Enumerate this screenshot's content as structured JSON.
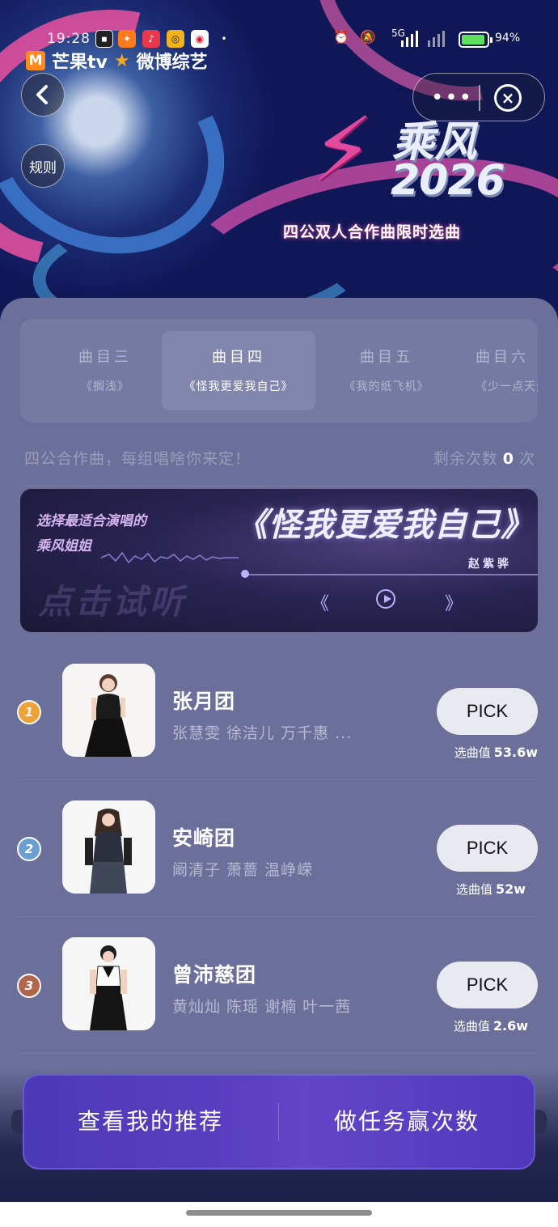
{
  "status_bar": {
    "time": "19:28",
    "network": "5G",
    "battery_level": 94,
    "battery_text": "94%",
    "app_icons": [
      "icon-a",
      "icon-b",
      "icon-c",
      "icon-d",
      "weibo-icon"
    ]
  },
  "header": {
    "brand_mango": "芒果tv",
    "brand_weibo": "微博综艺",
    "rules_label": "规则",
    "show_name": "乘风",
    "show_year": "2026",
    "subtitle": "四公双人合作曲限时选曲"
  },
  "tabs": [
    {
      "title": "曲目三",
      "song": "《搁浅》",
      "active": false
    },
    {
      "title": "曲目四",
      "song": "《怪我更爱我自己》",
      "active": true
    },
    {
      "title": "曲目五",
      "song": "《我的纸飞机》",
      "active": false
    },
    {
      "title": "曲目六",
      "song": "《少一点天分》",
      "active": false
    }
  ],
  "info": {
    "tagline": "四公合作曲，每组唱啥你来定！",
    "remaining_label": "剩余次数",
    "remaining_count": "0",
    "remaining_unit": "次"
  },
  "song_banner": {
    "tag_line1": "选择最适合演唱的",
    "tag_line2": "乘风姐姐",
    "song_title": "《怪我更爱我自己》",
    "artist": "赵紫骅",
    "listen_label": "点击试听"
  },
  "teams": [
    {
      "rank": "1",
      "name": "张月团",
      "members": "张慧雯 徐洁儿 万千惠 ...",
      "pick_label": "PICK",
      "value_label": "选曲值",
      "value": "53.6w",
      "rank_color": "#f0a23a"
    },
    {
      "rank": "2",
      "name": "安崎团",
      "members": "阚清子 萧蔷 温峥嵘",
      "pick_label": "PICK",
      "value_label": "选曲值",
      "value": "52w",
      "rank_color": "#6b9fd4"
    },
    {
      "rank": "3",
      "name": "曾沛慈团",
      "members": "黄灿灿 陈瑶 谢楠 叶一茜",
      "pick_label": "PICK",
      "value_label": "选曲值",
      "value": "2.6w",
      "rank_color": "#b2674c"
    }
  ],
  "bottom_bar": {
    "left_label": "查看我的推荐",
    "right_label": "做任务赢次数"
  },
  "colors": {
    "card_bg": "#6b6f99",
    "bar_accent": "#5b40c2"
  }
}
